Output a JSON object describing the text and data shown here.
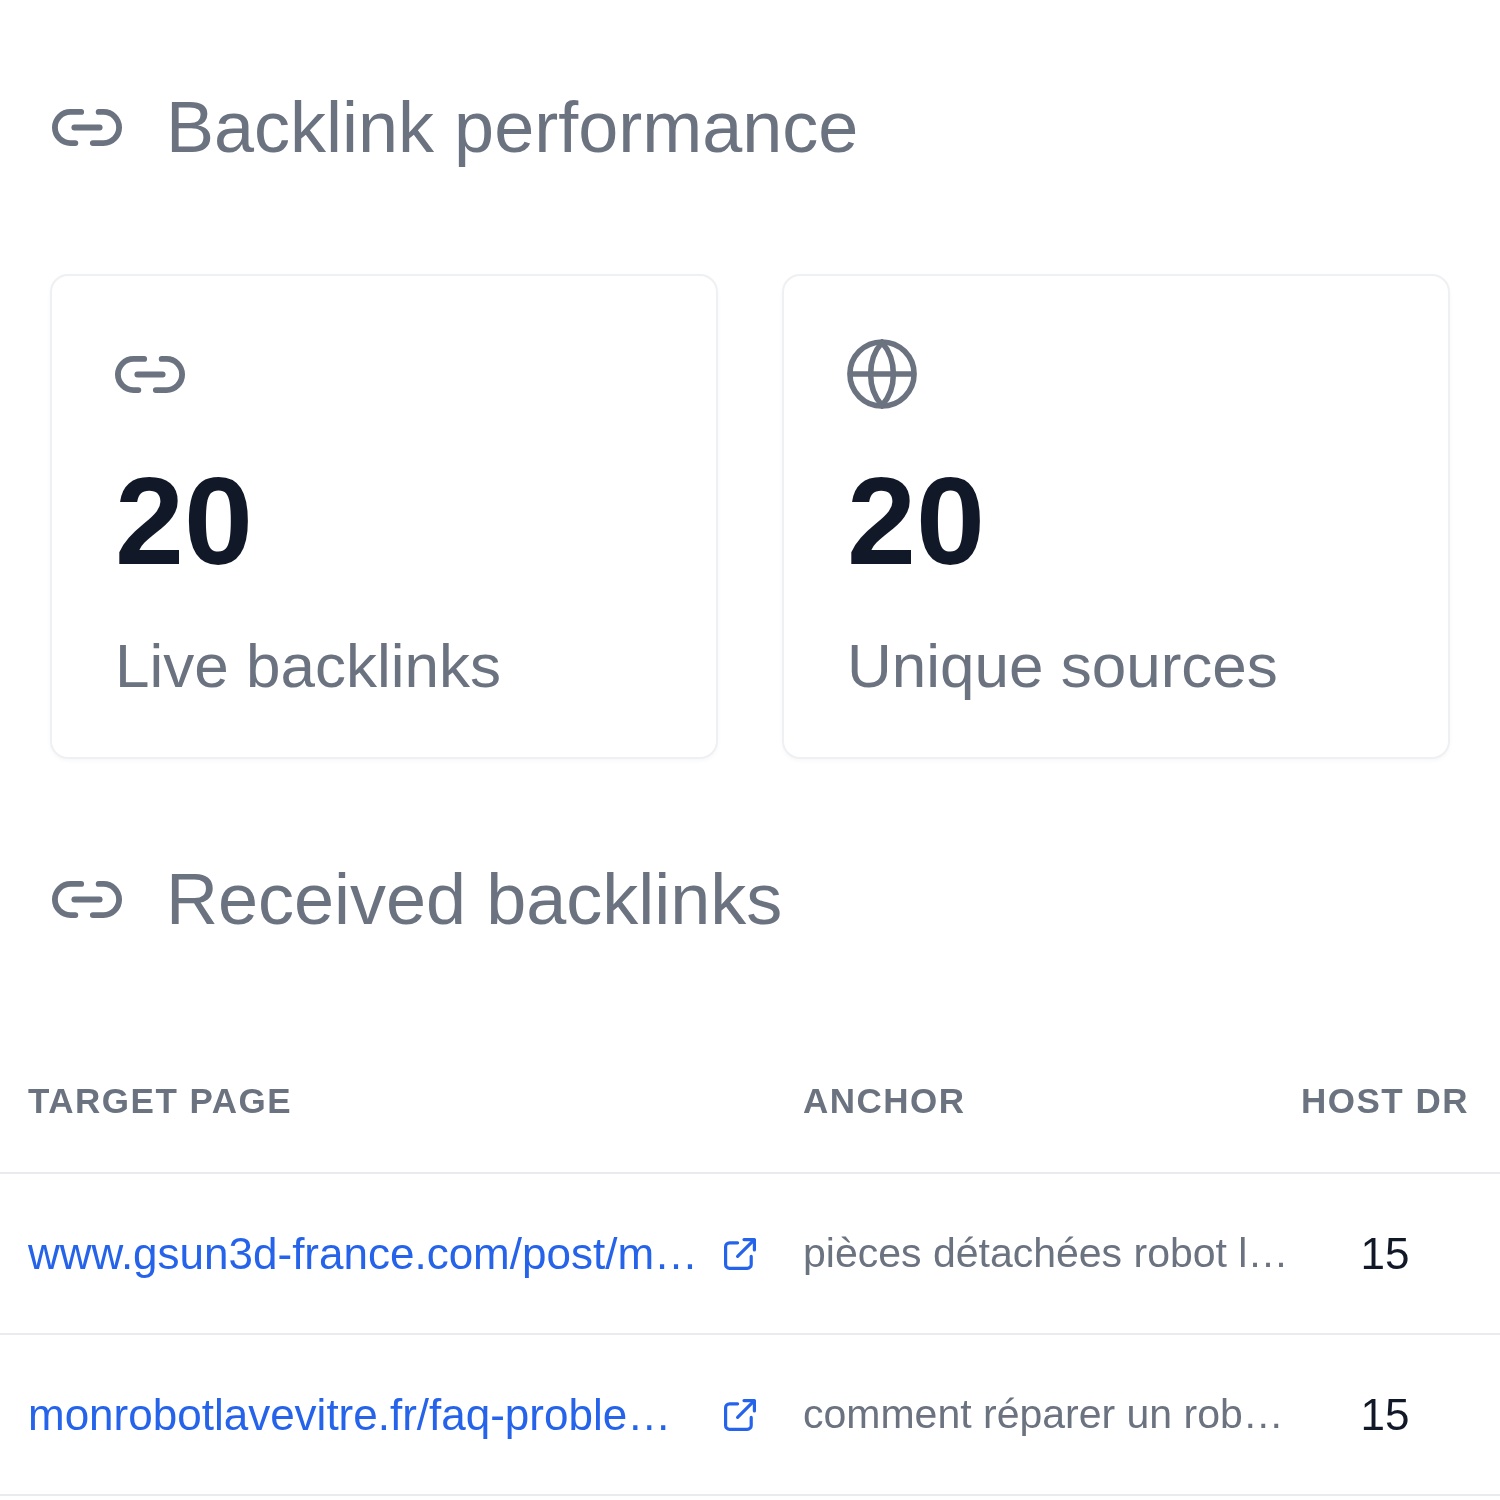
{
  "performance": {
    "title": "Backlink performance",
    "stats": [
      {
        "kind": "link",
        "value": "20",
        "label": "Live backlinks"
      },
      {
        "kind": "globe",
        "value": "20",
        "label": "Unique sources"
      }
    ]
  },
  "received": {
    "title": "Received backlinks",
    "table": {
      "columns": [
        "TARGET PAGE",
        "ANCHOR",
        "HOST DR"
      ],
      "rows": [
        {
          "target_page": "www.gsun3d-france.com/post/m…",
          "anchor": "pièces détachées robot l…",
          "host_dr": "15"
        },
        {
          "target_page": "monrobotlavevitre.fr/faq-proble…",
          "anchor": "comment réparer un rob…",
          "host_dr": "15"
        }
      ]
    }
  }
}
